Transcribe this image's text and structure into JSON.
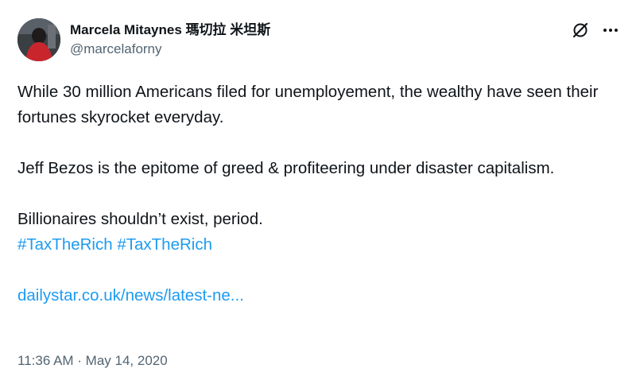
{
  "author": {
    "display_name": "Marcela Mitaynes 瑪切拉 米坦斯",
    "handle": "@marcelaforny"
  },
  "icons": {
    "grok": "grok-icon",
    "more": "more-icon",
    "avatar": "avatar"
  },
  "tweet": {
    "line1": "While 30 million Americans filed for unemployement, the wealthy have seen their fortunes skyrocket everyday.",
    "line2": "Jeff Bezos is the epitome of greed & profiteering under disaster capitalism.",
    "line3": "Billionaires shouldn’t exist, period.",
    "hashtag1": "#TaxTheRich",
    "hashtag2": "#TaxTheRich",
    "link": "dailystar.co.uk/news/latest-ne..."
  },
  "meta": {
    "timestamp": "11:36 AM · May 14, 2020"
  },
  "colors": {
    "text": "#0f1419",
    "secondary": "#536471",
    "link": "#1d9bf0"
  }
}
